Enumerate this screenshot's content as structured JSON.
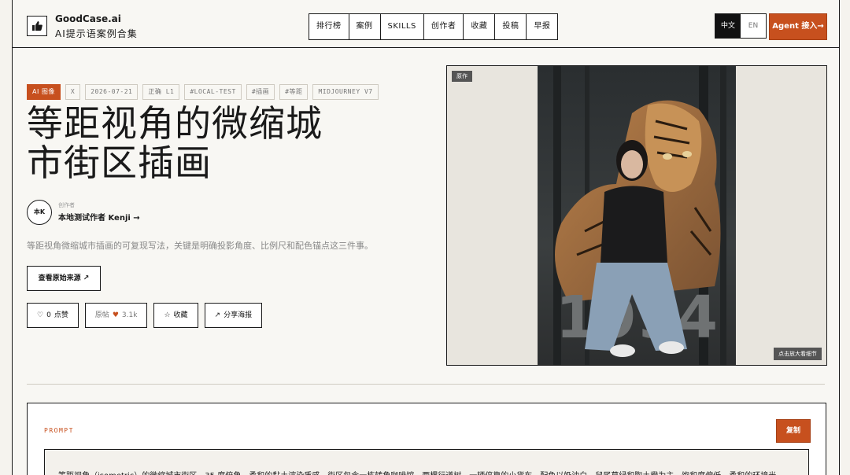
{
  "brand": {
    "name": "GoodCase.ai",
    "subtitle": "AI提示语案例合集",
    "icon": "thumbs-up-icon"
  },
  "nav": [
    "排行榜",
    "案例",
    "SKILLS",
    "创作者",
    "收藏",
    "投稿",
    "早报"
  ],
  "lang": {
    "active": "中文",
    "other": "EN"
  },
  "agent_button": "Agent 接入→",
  "tags": [
    "AI 图像",
    "X",
    "2026-07-21",
    "正确 L1",
    "#LOCAL-TEST",
    "#插画",
    "#等距",
    "MIDJOURNEY V7"
  ],
  "title": "等距视角的微缩城市街区插画",
  "author": {
    "avatar": "本K",
    "role": "创作者",
    "name": "本地测试作者 Kenji →"
  },
  "description": "等距视角微缩城市插画的可复现写法，关键是明确投影角度、比例尺和配色锚点这三件事。",
  "source_button": "查看原始来源 ↗",
  "actions": {
    "like_icon": "heart-outline-icon",
    "like_count": "0",
    "like_label": "点赞",
    "origin_label": "原帖",
    "origin_count": "3.1k",
    "save_label": "收藏",
    "share_label": "分享海报"
  },
  "image": {
    "badge": "原作",
    "zoom_hint": "点击放大看细节",
    "caption_number": "1994"
  },
  "prompt": {
    "label": "PROMPT",
    "copy": "复制",
    "text": "等距视角（isometric）的微缩城市街区，35 度俯角，柔和的黏土渲染质感，街区包含一栋转角咖啡馆、两棵行道树、一辆停靠的小货车。配色以奶油白、鼠尾草绿和陶土橙为主，饱和度偏低，柔和的环境光"
  },
  "colors": {
    "accent": "#c7501e",
    "background": "#f8f7f3",
    "ink": "#1a1a1a"
  }
}
